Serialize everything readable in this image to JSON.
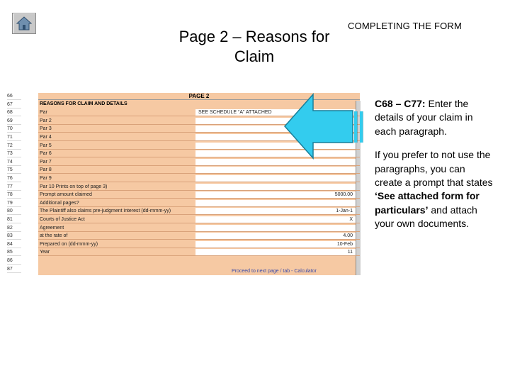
{
  "header_text": "COMPLETING THE FORM",
  "slide_title": "Page 2 – Reasons for Claim",
  "home_icon": "home-icon",
  "spreadsheet": {
    "title": "PAGE 2",
    "section": "REASONS FOR CLAIM AND DETAILS",
    "row_numbers": [
      "66",
      "67",
      "68",
      "69",
      "70",
      "71",
      "72",
      "73",
      "74",
      "75",
      "76",
      "77",
      "78",
      "79",
      "80",
      "81",
      "82",
      "83",
      "84",
      "85",
      "86",
      "87"
    ],
    "rows": [
      {
        "label": "Par",
        "value_left": "SEE SCHEDULE “A” ATTACHED",
        "value": ""
      },
      {
        "label": "Par 2",
        "value_left": "",
        "value": ""
      },
      {
        "label": "Par 3",
        "value_left": "",
        "value": ""
      },
      {
        "label": "Par 4",
        "value_left": "",
        "value": ""
      },
      {
        "label": "Par 5",
        "value_left": "",
        "value": ""
      },
      {
        "label": "Par 6",
        "value_left": "",
        "value": ""
      },
      {
        "label": "Par 7",
        "value_left": "",
        "value": ""
      },
      {
        "label": "Par 8",
        "value_left": "",
        "value": ""
      },
      {
        "label": "Par 9",
        "value_left": "",
        "value": ""
      },
      {
        "label": "Par 10 Prints on top of page 3)",
        "value_left": "",
        "value": ""
      },
      {
        "label": "Prompt amount claimed",
        "value_left": "",
        "value": "5000.00"
      },
      {
        "label": "Additional pages?",
        "value_left": "",
        "value": ""
      },
      {
        "label": "The Plaintiff also claims pre-judgment interest (dd-mmm-yy)",
        "value_left": "",
        "value": "1-Jan-1"
      },
      {
        "label": "  Courts of Justice Act",
        "value_left": "",
        "value": "X"
      },
      {
        "label": "  Agreement",
        "value_left": "",
        "value": ""
      },
      {
        "label": "  at the rate of",
        "value_left": "",
        "value": "4.00"
      },
      {
        "label": "Prepared on (dd-mmm-yy)",
        "value_left": "",
        "value": "10-Feb"
      },
      {
        "label": "  Year",
        "value_left": "",
        "value": "11"
      }
    ],
    "footer": "Proceed to next page / tab - Calculator"
  },
  "callout": {
    "range_label": "C68 – C77:",
    "range_text": " Enter the details of your claim in each paragraph.",
    "p2_before": "If you prefer to not use the paragraphs, you can create a prompt that states ",
    "p2_bold": "‘See attached form for particulars’",
    "p2_after": " and attach your own documents."
  },
  "colors": {
    "sheet_fill": "#f6c9a3",
    "arrow_fill": "#33ccee"
  }
}
